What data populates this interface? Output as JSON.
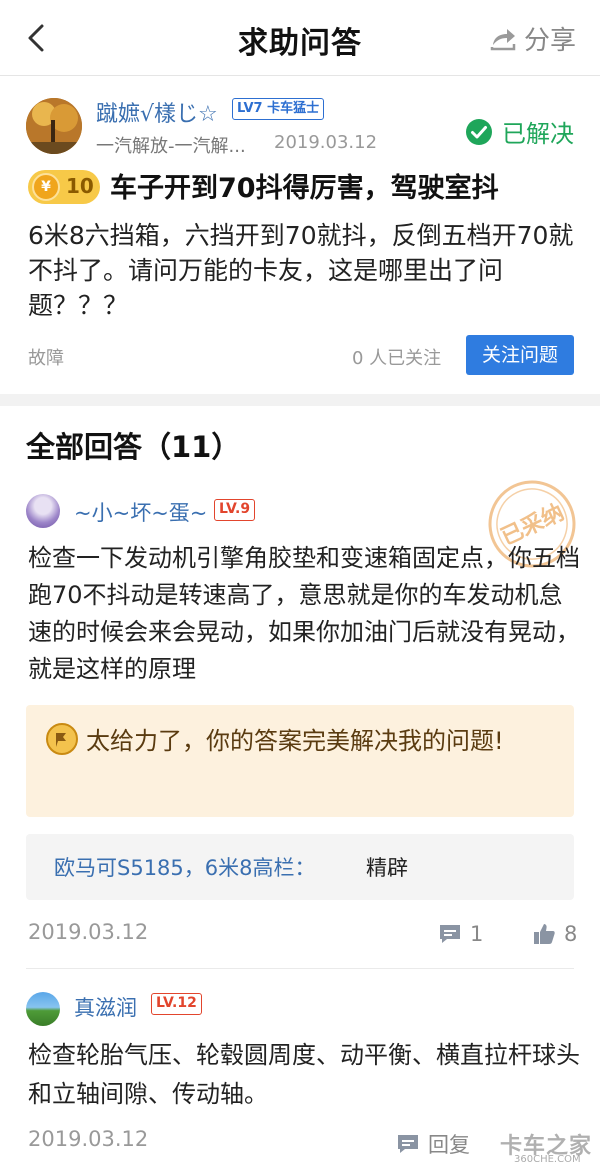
{
  "header": {
    "title": "求助问答",
    "share_label": "分享"
  },
  "question": {
    "username": "蹴嫬√樣じ☆",
    "level_badge": "LV7 卡车猛士",
    "brand": "一汽解放-一汽解...",
    "date": "2019.03.12",
    "status": "已解决",
    "reward_coins": "10",
    "title": "车子开到70抖得厉害，驾驶室抖",
    "body": "6米8六挡箱，六挡开到70就抖，反倒五档开70就不抖了。请问万能的卡友，这是哪里出了问题？？？",
    "tag": "故障",
    "follow_count": "0 人已关注",
    "follow_button": "关注问题"
  },
  "answers": {
    "section_title": "全部回答（11）",
    "items": [
      {
        "username": "~小~坏~蛋~",
        "level": "LV.9",
        "adopted_stamp": "已采纳",
        "body": "检查一下发动机引擎角胶垫和变速箱固定点，你五档跑70不抖动是转速高了，意思就是你的车发动机怠速的时候会来会晃动，如果你加油门后就没有晃动，就是这样的原理",
        "thanks_text": "太给力了，你的答案完美解决我的问题!",
        "car_model": "欧马可S5185，6米8高栏：",
        "car_owner": "精辟",
        "date": "2019.03.12",
        "comment_count": "1",
        "like_count": "8"
      },
      {
        "username": "真滋润",
        "level": "LV.12",
        "body": "检查轮胎气压、轮毂圆周度、动平衡、横直拉杆球头和立轴间隙、传动轴。",
        "date": "2019.03.12",
        "reply_label": "回复"
      }
    ]
  },
  "watermark": {
    "main": "卡车之家",
    "sub": "360CHE.COM"
  },
  "colors": {
    "link_blue": "#3a6fb0",
    "button_blue": "#2f7ce0",
    "solved_green": "#1fa65a",
    "level_red": "#e2452d",
    "thanks_bg": "#fdf1de"
  }
}
